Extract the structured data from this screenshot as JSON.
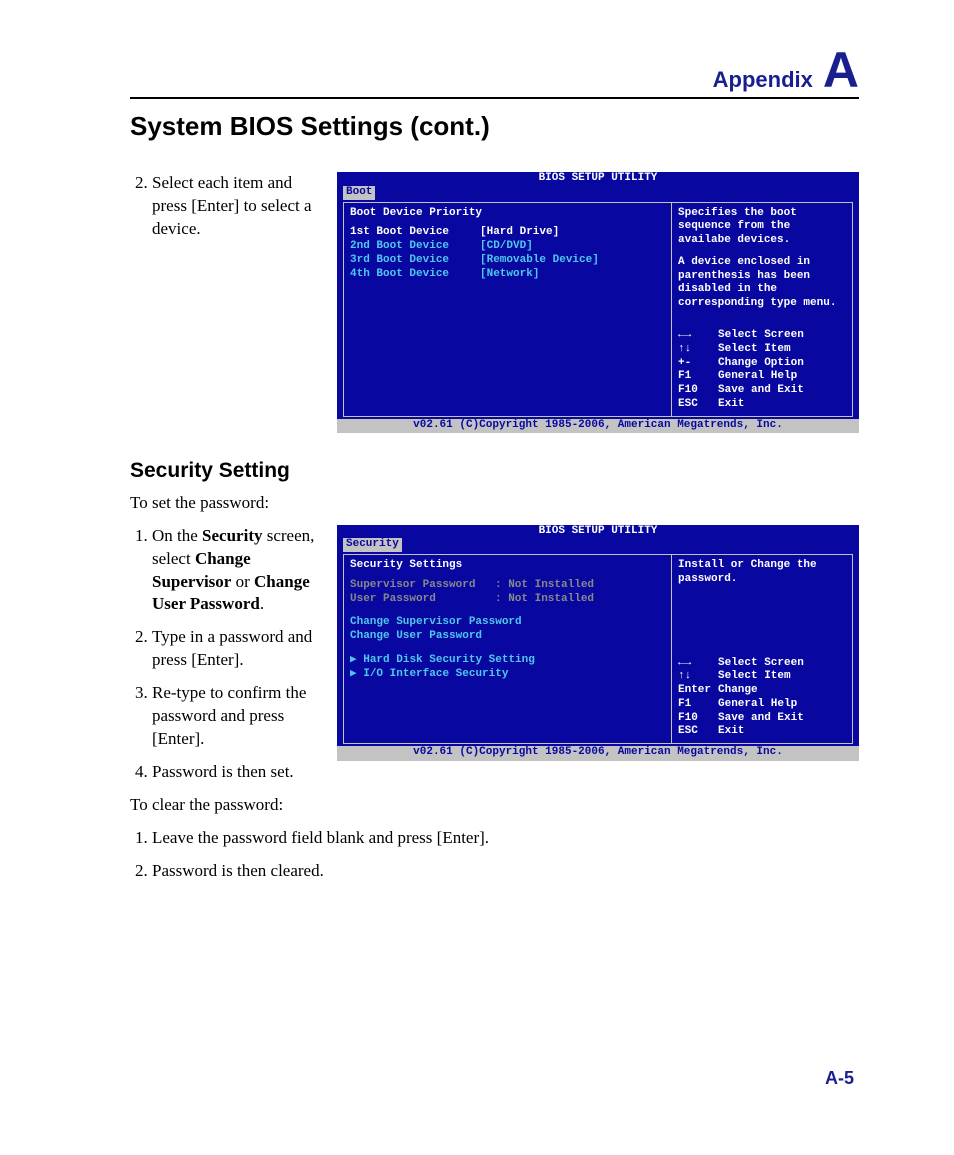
{
  "header": {
    "appendix_label": "Appendix",
    "appendix_letter": "A"
  },
  "title": "System BIOS Settings (cont.)",
  "step2": "Select each item and press [Enter] to select a device.",
  "bios1": {
    "utility_title": "BIOS SETUP UTILITY",
    "active_tab": "Boot",
    "heading": "Boot Device Priority",
    "rows": [
      {
        "label": "1st Boot Device",
        "value": "[Hard Drive]",
        "selected": true
      },
      {
        "label": "2nd Boot Device",
        "value": "[CD/DVD]",
        "selected": false
      },
      {
        "label": "3rd Boot Device",
        "value": "[Removable Device]",
        "selected": false
      },
      {
        "label": "4th Boot Device",
        "value": "[Network]",
        "selected": false
      }
    ],
    "help1": "Specifies the boot sequence from the availabe devices.",
    "help2": "A device enclosed in parenthesis has been disabled in the corresponding type menu.",
    "hints": [
      {
        "k": "←→",
        "v": "Select Screen"
      },
      {
        "k": "↑↓",
        "v": "Select Item"
      },
      {
        "k": "+-",
        "v": "Change Option"
      },
      {
        "k": "F1",
        "v": "General Help"
      },
      {
        "k": "F10",
        "v": "Save and Exit"
      },
      {
        "k": "ESC",
        "v": "Exit"
      }
    ],
    "footer": "v02.61 (C)Copyright 1985-2006, American Megatrends, Inc."
  },
  "security": {
    "title": "Security Setting",
    "intro": "To set the password:",
    "steps": {
      "s1a": "On the ",
      "s1b": "Security",
      "s1c": " screen, select ",
      "s1d": "Change Supervisor",
      "s1e": " or ",
      "s1f": "Change User Password",
      "s1g": ".",
      "s2": "Type in a password and press [Enter].",
      "s3": "Re-type to confirm the password and press [Enter].",
      "s4": "Password is then set."
    },
    "clear_intro": "To clear the password:",
    "clear_steps": {
      "c1": "Leave the password field blank and press [Enter].",
      "c2": "Password is then cleared."
    }
  },
  "bios2": {
    "utility_title": "BIOS SETUP UTILITY",
    "active_tab": "Security",
    "heading": "Security Settings",
    "status": [
      {
        "label": "Supervisor Password",
        "value": ": Not Installed"
      },
      {
        "label": "User Password",
        "value": ": Not Installed"
      }
    ],
    "actions": [
      "Change Supervisor Password",
      "Change User Password"
    ],
    "submenus": [
      "Hard Disk Security Setting",
      "I/O Interface Security"
    ],
    "help": "Install or Change the password.",
    "hints": [
      {
        "k": "←→",
        "v": "Select Screen"
      },
      {
        "k": "↑↓",
        "v": "Select Item"
      },
      {
        "k": "Enter",
        "v": "Change"
      },
      {
        "k": "F1",
        "v": "General Help"
      },
      {
        "k": "F10",
        "v": "Save and Exit"
      },
      {
        "k": "ESC",
        "v": "Exit"
      }
    ],
    "footer": "v02.61 (C)Copyright 1985-2006, American Megatrends, Inc."
  },
  "page_number": "A-5"
}
